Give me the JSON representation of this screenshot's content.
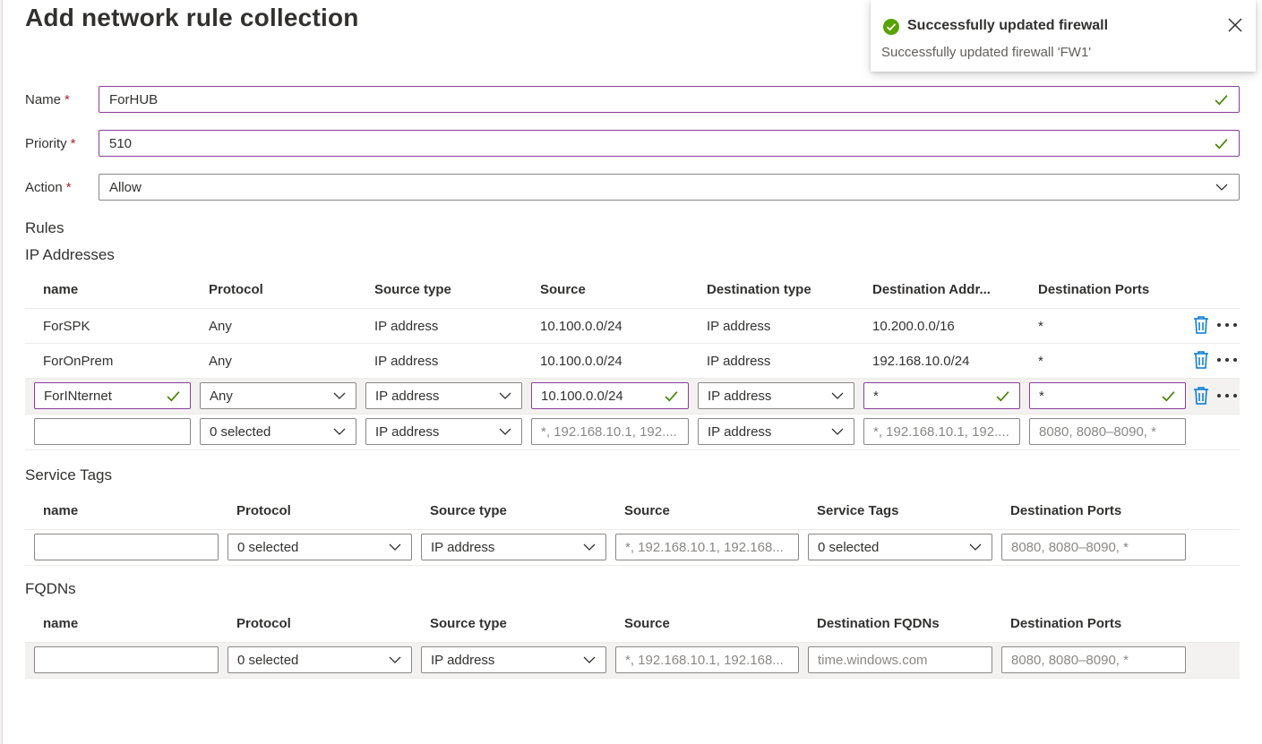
{
  "page": {
    "title": "Add network rule collection"
  },
  "form": {
    "name": {
      "label": "Name",
      "value": "ForHUB"
    },
    "priority": {
      "label": "Priority",
      "value": "510"
    },
    "action": {
      "label": "Action",
      "value": "Allow"
    },
    "required_mark": "*"
  },
  "rules": {
    "title": "Rules",
    "ip": {
      "title": "IP Addresses",
      "headers": [
        "name",
        "Protocol",
        "Source type",
        "Source",
        "Destination type",
        "Destination Addr...",
        "Destination Ports"
      ],
      "rows": [
        {
          "name": "ForSPK",
          "protocol": "Any",
          "source_type": "IP address",
          "source": "10.100.0.0/24",
          "dest_type": "IP address",
          "dest_addr": "10.200.0.0/16",
          "dest_ports": "*"
        },
        {
          "name": "ForOnPrem",
          "protocol": "Any",
          "source_type": "IP address",
          "source": "10.100.0.0/24",
          "dest_type": "IP address",
          "dest_addr": "192.168.10.0/24",
          "dest_ports": "*"
        }
      ],
      "editing": {
        "name": "ForINternet",
        "protocol": "Any",
        "source_type": "IP address",
        "source": "10.100.0.0/24",
        "dest_type": "IP address",
        "dest_addr": "*",
        "dest_ports": "*"
      },
      "new_row": {
        "name": "",
        "protocol": "0 selected",
        "source_type": "IP address",
        "source_placeholder": "*, 192.168.10.1, 192....",
        "dest_type": "IP address",
        "dest_addr_placeholder": "*, 192.168.10.1, 192....",
        "dest_ports_placeholder": "8080, 8080–8090, *"
      }
    },
    "service_tags": {
      "title": "Service Tags",
      "headers": [
        "name",
        "Protocol",
        "Source type",
        "Source",
        "Service Tags",
        "Destination Ports"
      ],
      "new_row": {
        "name": "",
        "protocol": "0 selected",
        "source_type": "IP address",
        "source_placeholder": "*, 192.168.10.1, 192.168...",
        "service_tags": "0 selected",
        "dest_ports_placeholder": "8080, 8080–8090, *"
      }
    },
    "fqdns": {
      "title": "FQDNs",
      "headers": [
        "name",
        "Protocol",
        "Source type",
        "Source",
        "Destination FQDNs",
        "Destination Ports"
      ],
      "new_row": {
        "name": "",
        "protocol": "0 selected",
        "source_type": "IP address",
        "source_placeholder": "*, 192.168.10.1, 192.168...",
        "dest_fqdns_placeholder": "time.windows.com",
        "dest_ports_placeholder": "8080, 8080–8090, *"
      }
    }
  },
  "toast": {
    "title": "Successfully updated firewall",
    "message": "Successfully updated firewall 'FW1'"
  },
  "icons": {
    "check": "checkmark-icon",
    "chevron": "chevron-down-icon",
    "trash": "trash-icon",
    "more": "more-icon",
    "success": "success-circle-icon",
    "close": "close-icon"
  },
  "colors": {
    "accent_valid_border": "#8a3d9c",
    "check_green": "#498205",
    "success_green": "#57a300",
    "required_red": "#a4262c",
    "link_blue": "#0078d4"
  }
}
